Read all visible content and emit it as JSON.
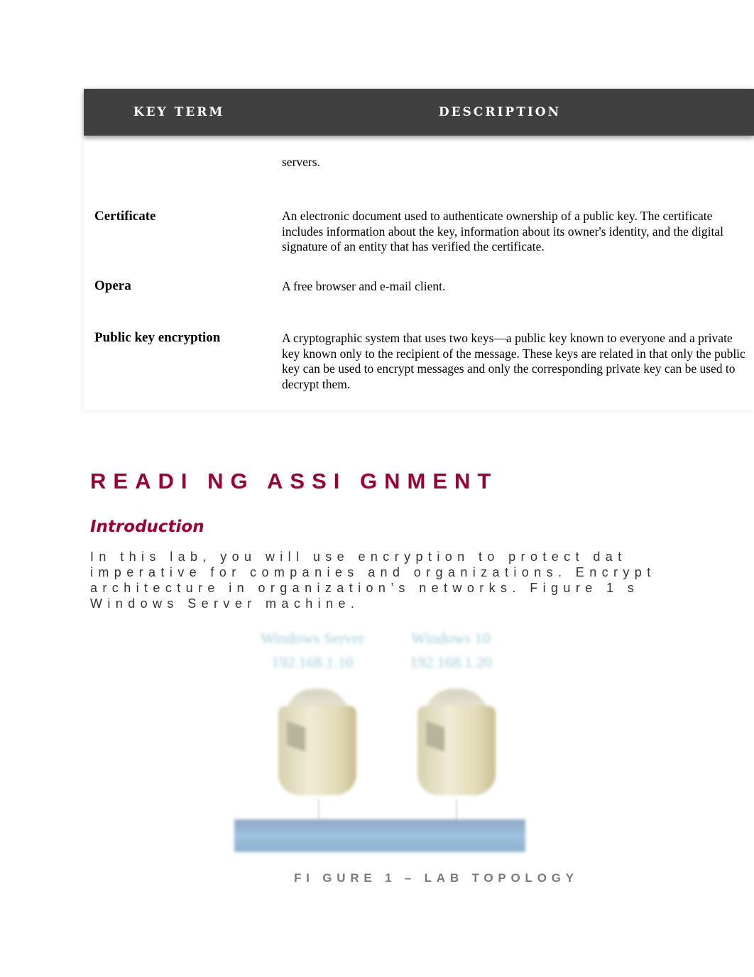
{
  "table": {
    "headers": {
      "key_term": "KEY TERM",
      "description": "DESCRIPTION"
    },
    "rows": [
      {
        "term": "",
        "description": "servers."
      },
      {
        "term": "Certificate",
        "description": "An electronic document used to authenticate ownership of a public key. The certificate includes information about the key, information about its owner's identity, and the digital signature of an entity that has verified the certificate."
      },
      {
        "term": "Opera",
        "description": "A free browser and e-mail client."
      },
      {
        "term": "Public key encryption",
        "description": "A cryptographic system that uses two keys—a public key known to everyone and a private key known only to the recipient of the message. These keys are related in that only the public key can be used to encrypt messages and only the corresponding private key can be used to decrypt them."
      }
    ]
  },
  "reading_assignment": {
    "title": "READI NG  ASSI GNMENT",
    "subheading": "Introduction",
    "intro_lines": [
      "In this lab, you will use encryption to protect dat",
      "imperative for companies and organizations. Encrypt",
      "architecture in organization’s networks. Figure 1 s",
      "Windows Server machine."
    ]
  },
  "figure": {
    "nodes": [
      {
        "label_line1": "Windows Server",
        "label_line2": "192.168.1.10",
        "icon": "server-icon"
      },
      {
        "label_line1": "Windows 10",
        "label_line2": "192.168.1.20",
        "icon": "server-icon"
      }
    ],
    "caption": "FI GURE 1 – LAB TOPOLOGY"
  }
}
